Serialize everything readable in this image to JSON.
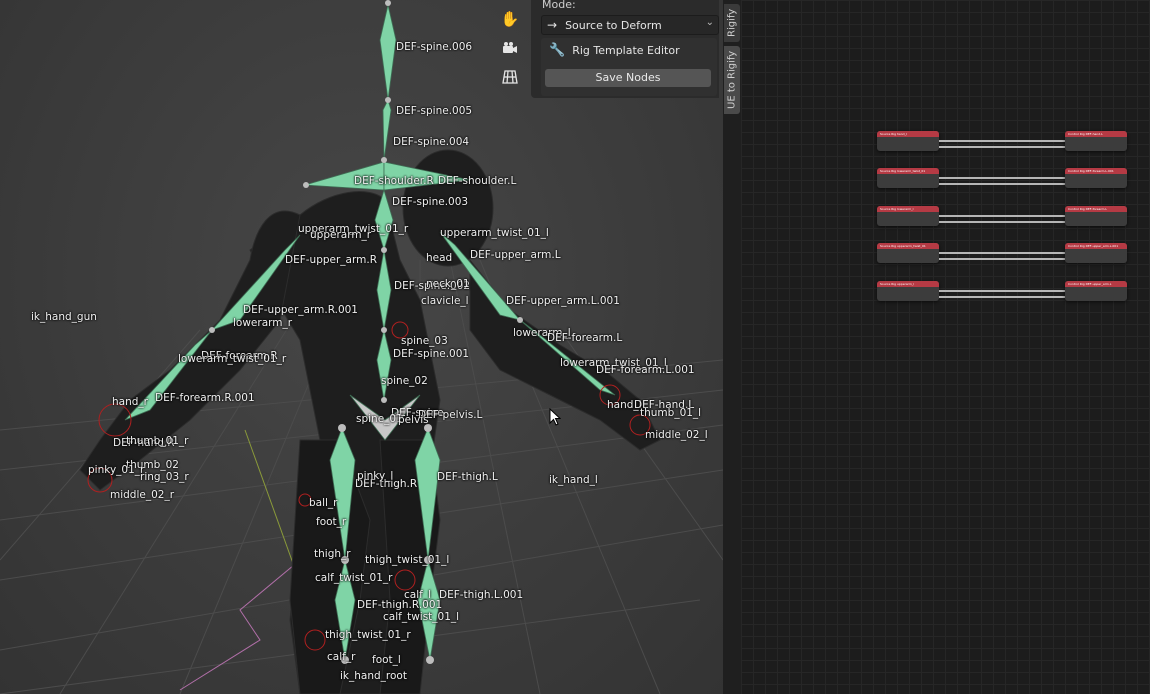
{
  "viewport": {
    "bone_labels": [
      "DEF-spine.006",
      "DEF-spine.005",
      "DEF-spine.004",
      "DEF-shoulder.R",
      "DEF-shoulder.L",
      "DEF-spine.003",
      "upperarm_twist_01_r",
      "upperarm_r",
      "upperarm_twist_01_l",
      "DEF-upper_arm.R",
      "head",
      "DEF-upper_arm.L",
      "DEF-spine.002",
      "neck_01",
      "clavicle_l",
      "DEF-upper_arm.L.001",
      "DEF-upper_arm.R.001",
      "lowerarm_r",
      "lowerarm_l",
      "DEF-forearm.L",
      "spine_03",
      "DEF-spine.001",
      "DEF-forearm.R",
      "lowerarm_twist_01_r",
      "lowerarm_twist_01_l",
      "DEF-forearm.L.001",
      "spine_02",
      "hand_r",
      "DEF-forearm.R.001",
      "hand_l",
      "DEF-hand.L",
      "DEF-spine",
      "DEF-pelvis.L",
      "spine_01",
      "pelvis",
      "thumb_01_l",
      "DEF-hand.R",
      "thumb_01_r",
      "middle_02_l",
      "thumb_02",
      "pinky_01_r",
      "ring_03_r",
      "middle_02_r",
      "DEF-thigh.R",
      "pinky_l",
      "DEF-thigh.L",
      "ik_hand_l",
      "ik_hand_gun",
      "ball_r",
      "foot_r",
      "thigh_r",
      "thigh_twist_01_l",
      "calf_twist_01_r",
      "calf_l",
      "DEF-thigh.L.001",
      "DEF-thigh.R.001",
      "calf_twist_01_l",
      "thigh_twist_01_r",
      "calf_r",
      "foot_l",
      "ik_hand_root"
    ],
    "tools": [
      "hand-icon",
      "camera-icon",
      "grid-icon"
    ]
  },
  "npanel": {
    "mode_label": "Mode:",
    "mode_value": "Source to Deform",
    "rig_template_editor": "Rig Template Editor",
    "save_nodes": "Save Nodes"
  },
  "tabs": {
    "rigify": "Rigify",
    "ue_to_rigify": "UE to Rigify"
  },
  "nodes": {
    "source_headers": [
      "Source Rig hand_l",
      "Source Rig lowerarm_twist_01",
      "Source Rig lowerarm_l",
      "Source Rig upperarm_twist_01",
      "Source Rig upperarm_l"
    ],
    "target_headers": [
      "Control Rig DEF-hand.L",
      "Control Rig DEF-forearm.L.001",
      "Control Rig DEF-forearm.L",
      "Control Rig DEF-upper_arm.L.001",
      "Control Rig DEF-upper_arm.L"
    ]
  },
  "colors": {
    "bone": "#7fd4a6",
    "node_header": "#b53a44",
    "viewport_bg": "#3f3f3f"
  }
}
